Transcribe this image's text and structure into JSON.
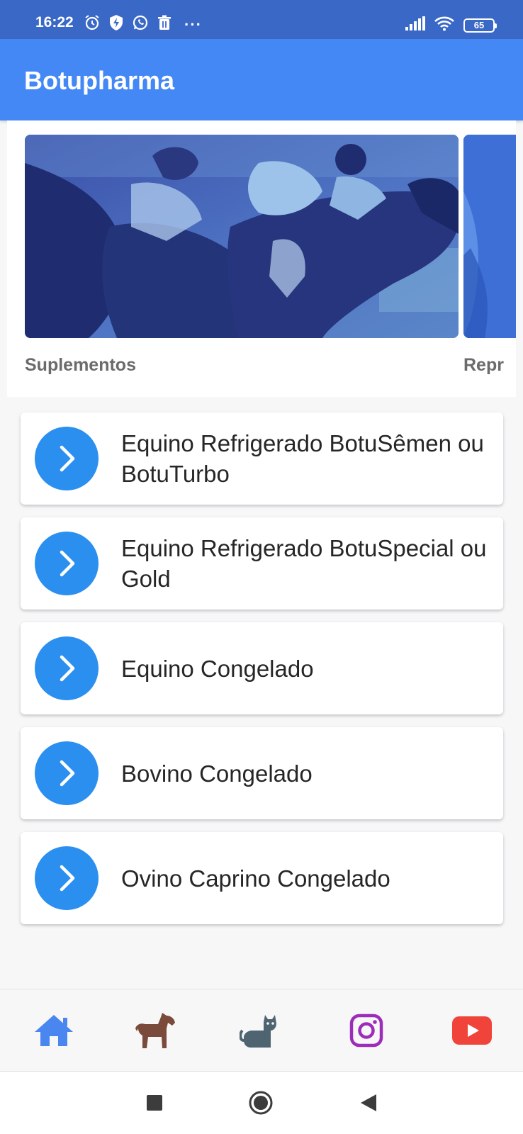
{
  "status_bar": {
    "time": "16:22",
    "icons_left": [
      "alarm-icon",
      "shield-bolt-icon",
      "whatsapp-icon",
      "trash-icon"
    ],
    "more": "···",
    "icons_right": [
      "signal-icon",
      "wifi-icon",
      "battery-icon"
    ],
    "battery_level": "65"
  },
  "app_bar": {
    "title": "Botupharma"
  },
  "carousel": {
    "slides": [
      {
        "caption": "Suplementos",
        "image": "horse-racing-photo"
      },
      {
        "caption": "Repr",
        "image": "blue-photo"
      }
    ]
  },
  "list": {
    "items": [
      {
        "label": "Equino Refrigerado BotuSêmen ou BotuTurbo",
        "icon": "chevron-right-icon"
      },
      {
        "label": "Equino Refrigerado BotuSpecial ou Gold",
        "icon": "chevron-right-icon"
      },
      {
        "label": "Equino Congelado",
        "icon": "chevron-right-icon"
      },
      {
        "label": "Bovino Congelado",
        "icon": "chevron-right-icon"
      },
      {
        "label": "Ovino Caprino Congelado",
        "icon": "chevron-right-icon"
      }
    ]
  },
  "bottom_nav": {
    "items": [
      {
        "icon": "home-icon",
        "color": "#4a86f0",
        "active": true
      },
      {
        "icon": "horse-icon",
        "color": "#7a4a3b"
      },
      {
        "icon": "cat-icon",
        "color": "#4e6470"
      },
      {
        "icon": "instagram-icon",
        "color": "#9c2db8"
      },
      {
        "icon": "youtube-icon",
        "color": "#f0443a"
      }
    ]
  },
  "system_nav": {
    "buttons": [
      "recent-apps-icon",
      "home-button-icon",
      "back-icon"
    ]
  },
  "colors": {
    "status_bar": "#3a68c6",
    "app_bar": "#4388f5",
    "accent": "#2b8ff0"
  }
}
